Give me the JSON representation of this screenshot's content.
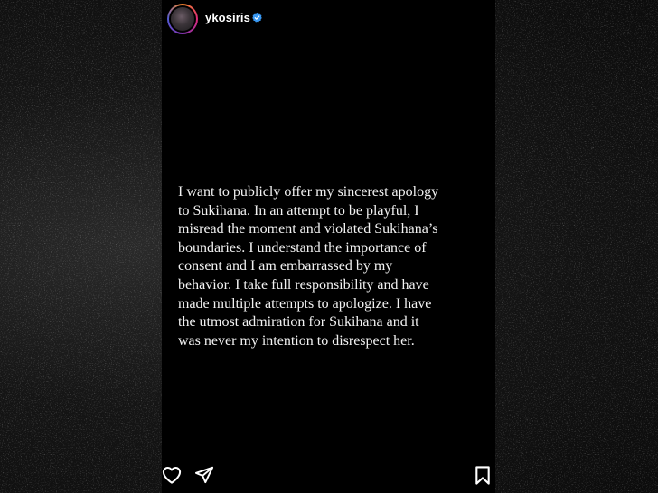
{
  "story": {
    "username": "ykosiris",
    "verified": true,
    "text": "I want to publicly offer my sincerest apology\nto Sukihana. In an attempt to be playful, I\nmisread the moment and violated Sukihana’s\nboundaries. I understand the importance of\nconsent and I am embarrassed by my\nbehavior. I take full responsibility and have\nmade multiple attempts to apologize. I have\nthe utmost admiration for Sukihana and it\nwas never my intention to disrespect her."
  },
  "icons": {
    "verified": "verified-badge-icon",
    "like": "heart-icon",
    "share": "send-icon",
    "save": "bookmark-icon"
  },
  "colors": {
    "verified_blue": "#3897f0",
    "story_bg": "#000000",
    "text": "#f2f2f2"
  }
}
